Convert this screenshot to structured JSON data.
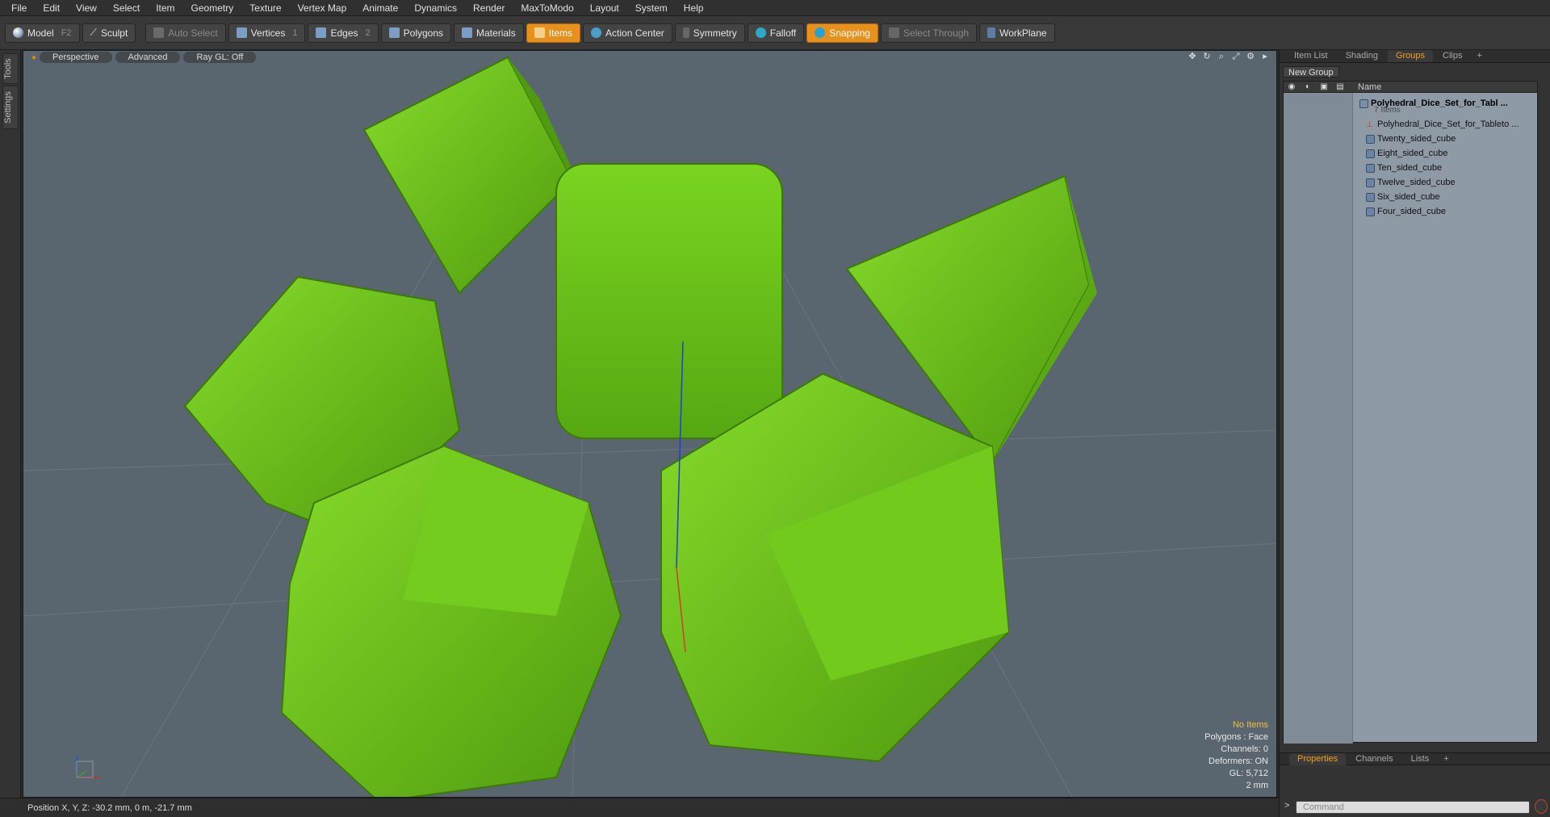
{
  "menu": [
    "File",
    "Edit",
    "View",
    "Select",
    "Item",
    "Geometry",
    "Texture",
    "Vertex Map",
    "Animate",
    "Dynamics",
    "Render",
    "MaxToModo",
    "Layout",
    "System",
    "Help"
  ],
  "toolbar": {
    "model": "Model",
    "model_key": "F2",
    "sculpt": "Sculpt",
    "auto_select": "Auto Select",
    "vertices": "Vertices",
    "vertices_key": "1",
    "edges": "Edges",
    "edges_key": "2",
    "polygons": "Polygons",
    "materials": "Materials",
    "items": "Items",
    "action_center": "Action Center",
    "symmetry": "Symmetry",
    "falloff": "Falloff",
    "snapping": "Snapping",
    "select_through": "Select Through",
    "workplane": "WorkPlane"
  },
  "left_tabs": {
    "tools": "Tools",
    "settings": "Settings"
  },
  "viewport": {
    "view": "Perspective",
    "shading": "Advanced",
    "raygl": "Ray GL: Off",
    "hud": {
      "items": "No Items",
      "polygons": "Polygons : Face",
      "channels": "Channels: 0",
      "deformers": "Deformers: ON",
      "gl": "GL: 5,712",
      "scale": "2 mm"
    },
    "dice_color": "#6cc21a"
  },
  "status": {
    "position": "Position X, Y, Z:  -30.2 mm, 0 m, -21.7 mm"
  },
  "right_panel": {
    "tabs": [
      "Item List",
      "Shading",
      "Groups",
      "Clips"
    ],
    "active_tab": "Groups",
    "new_group": "New Group",
    "name_header": "Name",
    "group_name": "Polyhedral_Dice_Set_for_Tabl ...",
    "group_count": "7 Items",
    "items": [
      {
        "label": "Polyhedral_Dice_Set_for_Tableto ...",
        "icon": "locator-icon"
      },
      {
        "label": "Twenty_sided_cube",
        "icon": "mesh-icon"
      },
      {
        "label": "Eight_sided_cube",
        "icon": "mesh-icon"
      },
      {
        "label": "Ten_sided_cube",
        "icon": "mesh-icon"
      },
      {
        "label": "Twelve_sided_cube",
        "icon": "mesh-icon"
      },
      {
        "label": "Six_sided_cube",
        "icon": "mesh-icon"
      },
      {
        "label": "Four_sided_cube",
        "icon": "mesh-icon"
      }
    ],
    "bottom_tabs": [
      "Properties",
      "Channels",
      "Lists"
    ],
    "bottom_active": "Properties",
    "command_placeholder": "Command"
  }
}
